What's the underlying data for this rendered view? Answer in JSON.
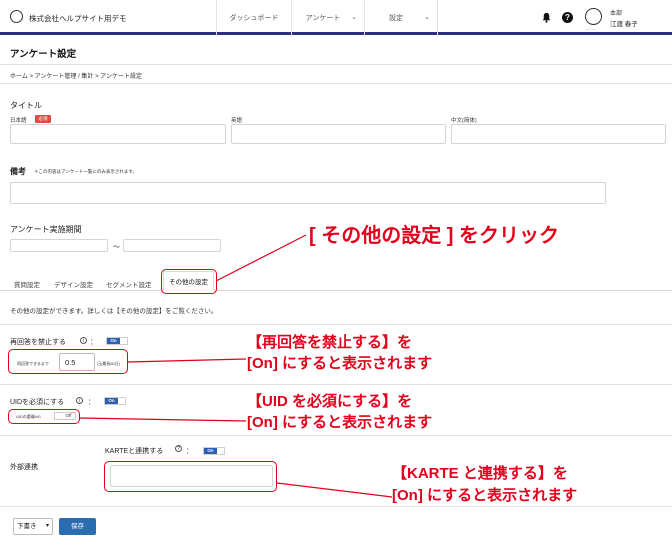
{
  "header": {
    "company": "株式会社ヘルプサイト用デモ",
    "nav": [
      {
        "label": "ダッシュボード"
      },
      {
        "label": "アンケート"
      },
      {
        "label": "設定"
      }
    ],
    "user_department": "本部",
    "user_name": "江渡 春子",
    "avatar_caption": "~~~~~~",
    "accent_color": "#2c2f7e"
  },
  "page": {
    "title": "アンケート設定",
    "breadcrumb": "ホーム > アンケート管理 / 集計 > アンケート設定"
  },
  "form": {
    "title_label": "タイトル",
    "lang_ja": "日本語",
    "required_badge": "必須",
    "lang_en": "英語",
    "lang_zh": "中文(简体)",
    "note_label": "備考",
    "note_hint": "＊この内容はアンケート一覧にのみ表示されます。",
    "period_label": "アンケート実施期間",
    "period_sep": "〜",
    "tabs": [
      "質問設定",
      "デザイン設定",
      "セグメント設定",
      "その他の設定"
    ],
    "other_desc": "その他の設定ができます。詳しくは【その他の設定】をご覧ください。",
    "reanswer_label": "再回答を禁止する",
    "reanswer_toggle": "On",
    "reanswer_interval_prefix": "再回答できるまで",
    "reanswer_interval_value": "0.5",
    "reanswer_interval_suffix": "日(最長60日)",
    "uid_label": "UIDを必須にする",
    "uid_toggle": "On",
    "uid_sub_label": "UIDの重複NG",
    "uid_sub_toggle": "Off",
    "external_label": "外部連携",
    "karte_label": "KARTEと連携する",
    "karte_toggle": "On",
    "select_value": "下書き",
    "save_label": "保存",
    "colon": "："
  },
  "annotations": {
    "click_note": "[ その他の設定 ] をクリック",
    "reanswer_note_1": "【再回答を禁止する】を",
    "reanswer_note_2": "[On] にすると表示されます",
    "uid_note_1": "【UID を必須にする】を",
    "uid_note_2": "[On] にすると表示されます",
    "karte_note_1": "【KARTE と連携する】を",
    "karte_note_2": "[On] にすると表示されます",
    "color": "#e3001b"
  }
}
